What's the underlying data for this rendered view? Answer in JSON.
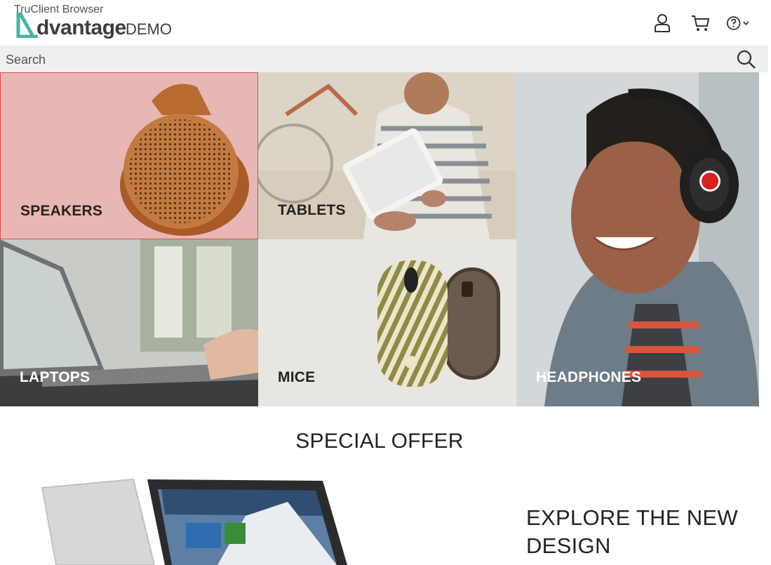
{
  "browser_label": "TruClient Browser",
  "logo": {
    "text": "dvantage",
    "demo": "DEMO"
  },
  "header": {
    "icons": [
      "user-icon",
      "cart-icon",
      "help-icon",
      "chevron-down-icon"
    ]
  },
  "search": {
    "placeholder": "Search"
  },
  "categories": [
    {
      "label": "SPEAKERS"
    },
    {
      "label": "TABLETS"
    },
    {
      "label": "LAPTOPS"
    },
    {
      "label": "MICE"
    },
    {
      "label": "HEADPHONES"
    }
  ],
  "special_offer": {
    "title": "SPECIAL OFFER",
    "subtitle": "EXPLORE THE NEW DESIGN"
  },
  "colors": {
    "accent": "#46b4a6",
    "speakers_bg": "#e7b7b6",
    "selected_border": "#e14b4b"
  }
}
